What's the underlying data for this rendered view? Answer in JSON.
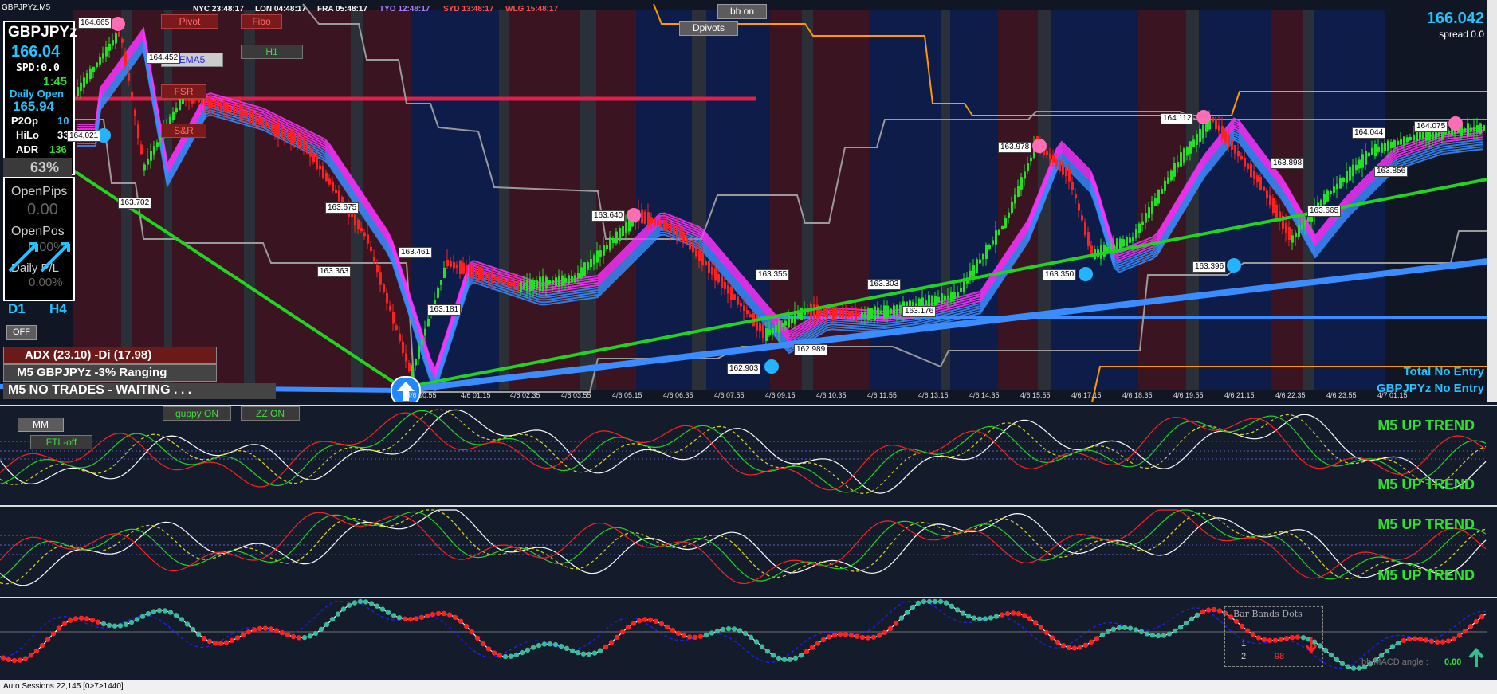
{
  "window": {
    "title": "GBPJPYz,M5"
  },
  "sessions": [
    {
      "text": "NYC 23:48:17",
      "color": "#ffffff"
    },
    {
      "text": "LON 04:48:17",
      "color": "#ffffff"
    },
    {
      "text": "FRA 05:48:17",
      "color": "#ffffff"
    },
    {
      "text": "TYO 12:48:17",
      "color": "#b080ff"
    },
    {
      "text": "SYD 13:48:17",
      "color": "#ff5050"
    },
    {
      "text": "WLG 15:48:17",
      "color": "#ff5050"
    }
  ],
  "buttons": {
    "pivot": "Pivot",
    "fibo": "Fibo",
    "h1": "H1",
    "ema5": "EMA5",
    "fsr": "FSR",
    "snr": "S&R",
    "bb_on": "bb on",
    "dpivots": "Dpivots",
    "off": "OFF",
    "guppy_on": "guppy ON",
    "zz_on": "ZZ ON",
    "mm": "MM",
    "ftl_off": "FTL-off"
  },
  "info_panel": {
    "symbol": "GBPJPYz",
    "price": "166.04",
    "spread": "SPD:0.0",
    "timer": "1:45",
    "daily_open_label": "Daily Open",
    "daily_open_value": "165.94",
    "p2op_label": "P2Op",
    "p2op_value": "10",
    "hilo_label": "HiLo",
    "hilo_value": "33",
    "adr_label": "ADR",
    "adr_value": "136",
    "percent": "63%",
    "open_pips_label": "OpenPips",
    "open_pips_value": "0.00",
    "open_pos_label": "OpenPos",
    "open_pos_value": "0.00%",
    "daily_pl_label": "Daily P/L",
    "daily_pl_value": "0.00%",
    "tf1": "D1",
    "tf2": "H4"
  },
  "status_bars": {
    "adx": "ADX (23.10)  -Di (17.98)",
    "ranging": "M5 GBPJPYz -3% Ranging",
    "trades": "M5  NO TRADES - WAITING . . ."
  },
  "top_right": {
    "price": "166.042",
    "spread": "spread 0.0"
  },
  "entry": {
    "total": "Total No Entry",
    "pair": "GBPJPYz No Entry"
  },
  "price_labels": [
    "164.665",
    "164.452",
    "164.021",
    "163.702",
    "163.675",
    "163.461",
    "163.363",
    "163.181",
    "163.640",
    "163.355",
    "163.303",
    "163.176",
    "162.989",
    "162.903",
    "163.978",
    "164.112",
    "163.350",
    "163.396",
    "163.898",
    "163.665",
    "164.044",
    "164.075",
    "163.856"
  ],
  "x_ticks": [
    "4/6 00:55",
    "4/6 01:15",
    "4/6 02:35",
    "4/6 03:55",
    "4/6 05:15",
    "4/6 06:35",
    "4/6 07:55",
    "4/6 09:15",
    "4/6 10:35",
    "4/6 11:55",
    "4/6 13:15",
    "4/6 14:35",
    "4/6 15:55",
    "4/6 17:15",
    "4/6 18:35",
    "4/6 19:55",
    "4/6 21:15",
    "4/6 22:35",
    "4/6 23:55",
    "4/7 01:15"
  ],
  "trends": {
    "t1": "M5 UP TREND",
    "t2": "M5 UP TREND",
    "t3": "M5 UP TREND",
    "t4": "M5 UP TREND"
  },
  "osc3_box": {
    "header": "Bar  Bands  Dots",
    "row1_num": "1",
    "row2_num": "2",
    "row2_val": "98"
  },
  "macd": {
    "label": "bb MACD angle :",
    "value": "0.00"
  },
  "statusbar": {
    "text": "Auto Sessions 22,145 [0>7>1440]"
  },
  "colors": {
    "ema_up": "#3a8cff",
    "ema_down": "#ff33ff",
    "trendline": "#22d322",
    "resistance": "#e0204a",
    "channel": "#ff9900"
  }
}
